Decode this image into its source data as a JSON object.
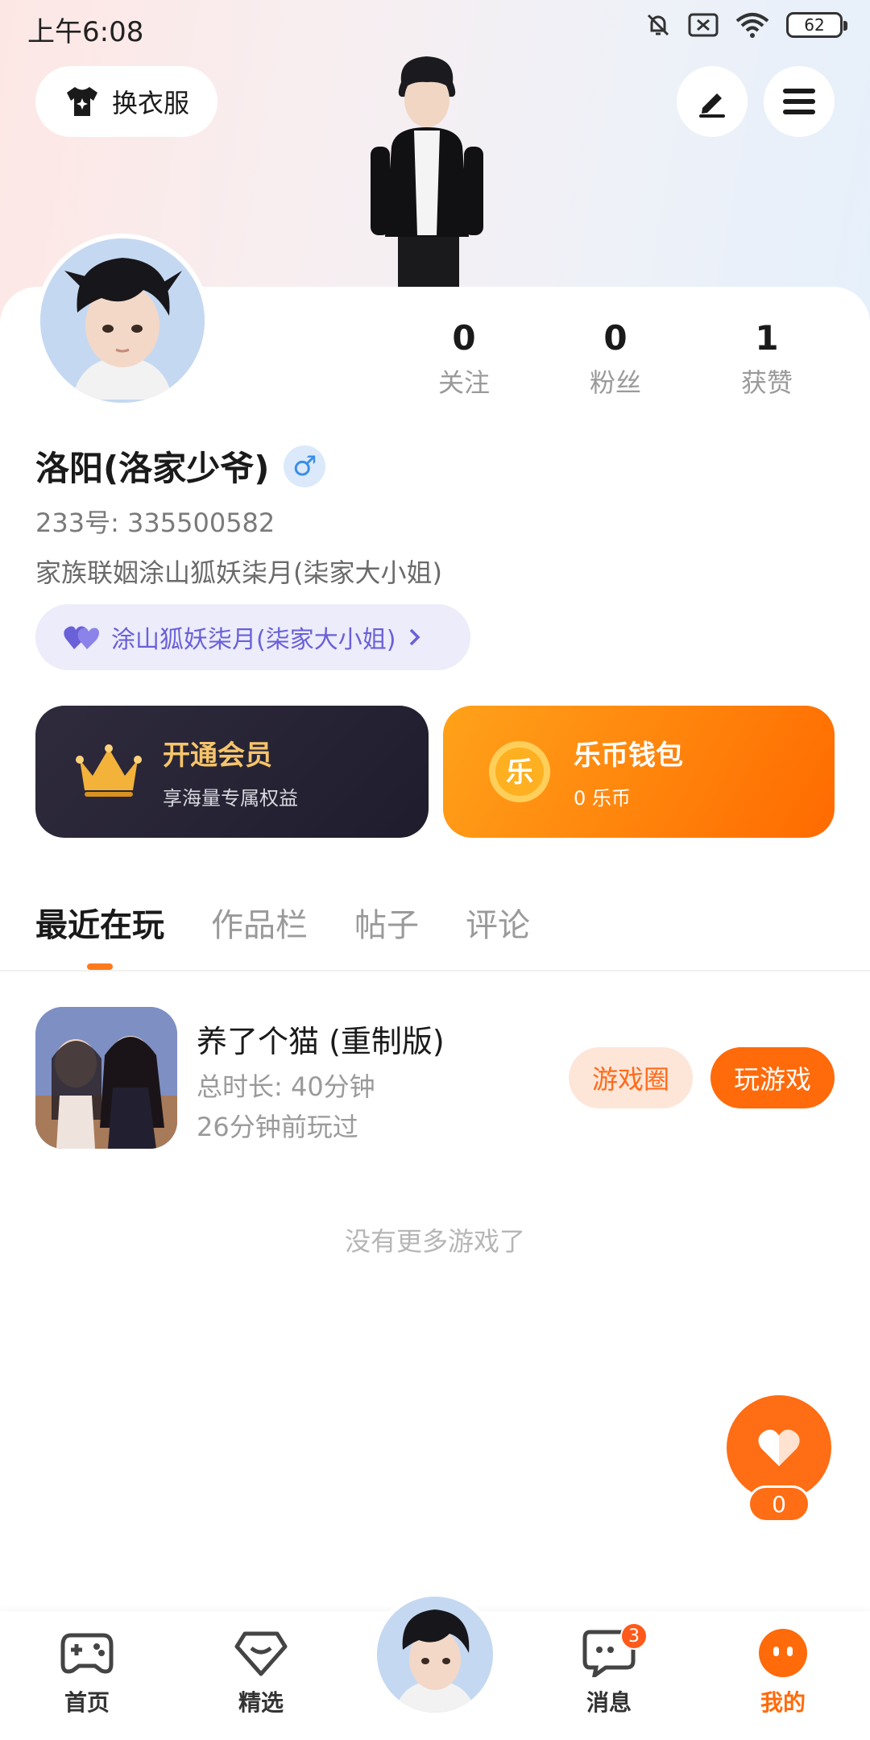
{
  "status_bar": {
    "time": "上午6:08",
    "battery": "62"
  },
  "header": {
    "outfit_label": "换衣服"
  },
  "stats": [
    {
      "value": "0",
      "label": "关注"
    },
    {
      "value": "0",
      "label": "粉丝"
    },
    {
      "value": "1",
      "label": "获赞"
    }
  ],
  "profile": {
    "name": "洛阳(洛家少爷)",
    "gender_symbol": "♂",
    "uid": "233号: 335500582",
    "bio": "家族联姻涂山狐妖柒月(柒家大小姐)",
    "relation": "涂山狐妖柒月(柒家大小姐)"
  },
  "cards": {
    "vip": {
      "title": "开通会员",
      "subtitle": "享海量专属权益"
    },
    "wallet": {
      "title": "乐币钱包",
      "subtitle": "0 乐币",
      "coin_glyph": "乐"
    }
  },
  "tabs": [
    "最近在玩",
    "作品栏",
    "帖子",
    "评论"
  ],
  "recent_game": {
    "title": "养了个猫 (重制版)",
    "duration": "总时长: 40分钟",
    "last_played": "26分钟前玩过",
    "circle_button": "游戏圈",
    "play_button": "玩游戏"
  },
  "no_more": "没有更多游戏了",
  "like": {
    "count": "0"
  },
  "bottom_nav": {
    "home": "首页",
    "featured": "精选",
    "messages": "消息",
    "messages_badge": "3",
    "mine": "我的"
  },
  "colors": {
    "accent": "#ff6a0a",
    "relation_text": "#6a60d8",
    "vip_gold": "#f6c46a"
  }
}
